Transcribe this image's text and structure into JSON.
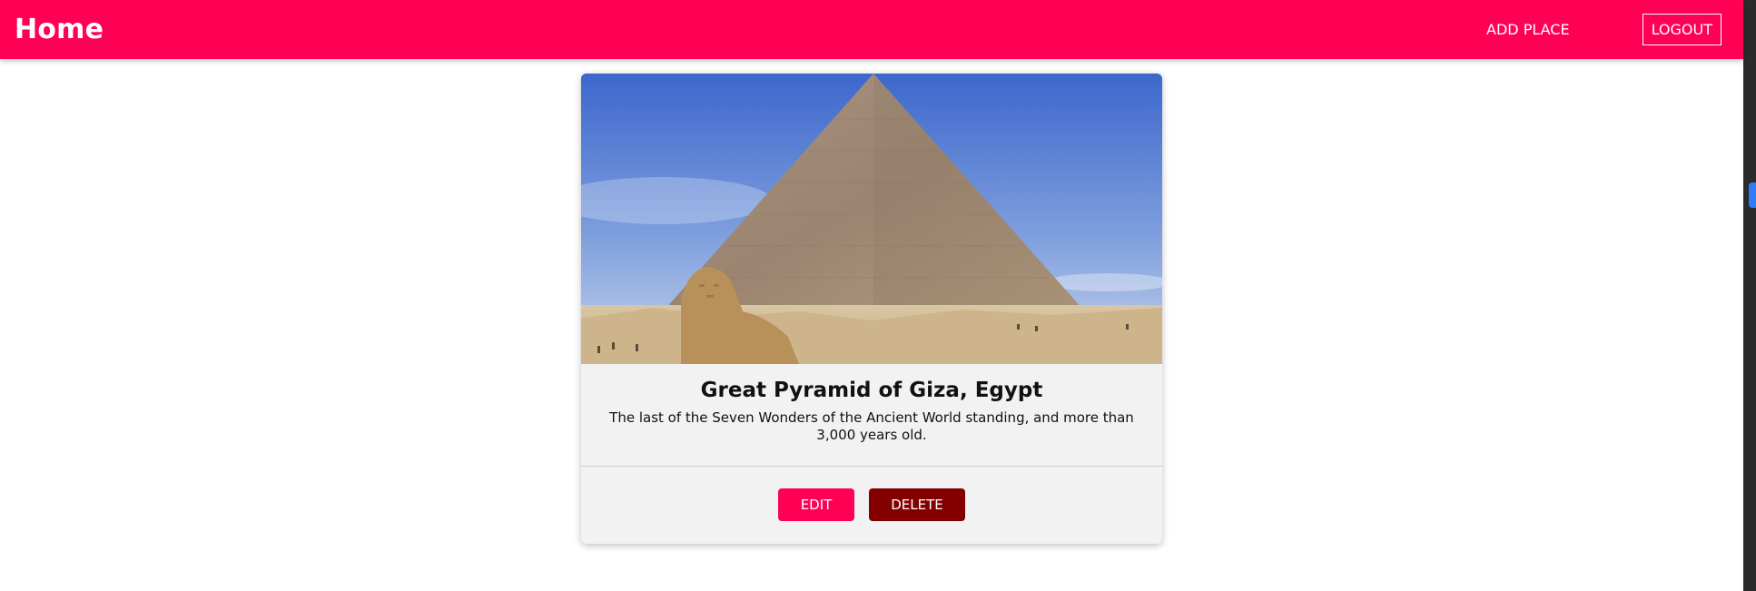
{
  "header": {
    "title": "Home",
    "add_place_label": "ADD PLACE",
    "logout_label": "LOGOUT"
  },
  "place": {
    "image_alt": "Great Pyramid of Giza, Egypt",
    "title": "Great Pyramid of Giza, Egypt",
    "description": "The last of the Seven Wonders of the Ancient World standing, and more than 3,000 years old.",
    "edit_label": "EDIT",
    "delete_label": "DELETE"
  },
  "colors": {
    "brand": "#ff0055",
    "danger": "#830000",
    "card_bg": "#f2f2f2"
  }
}
